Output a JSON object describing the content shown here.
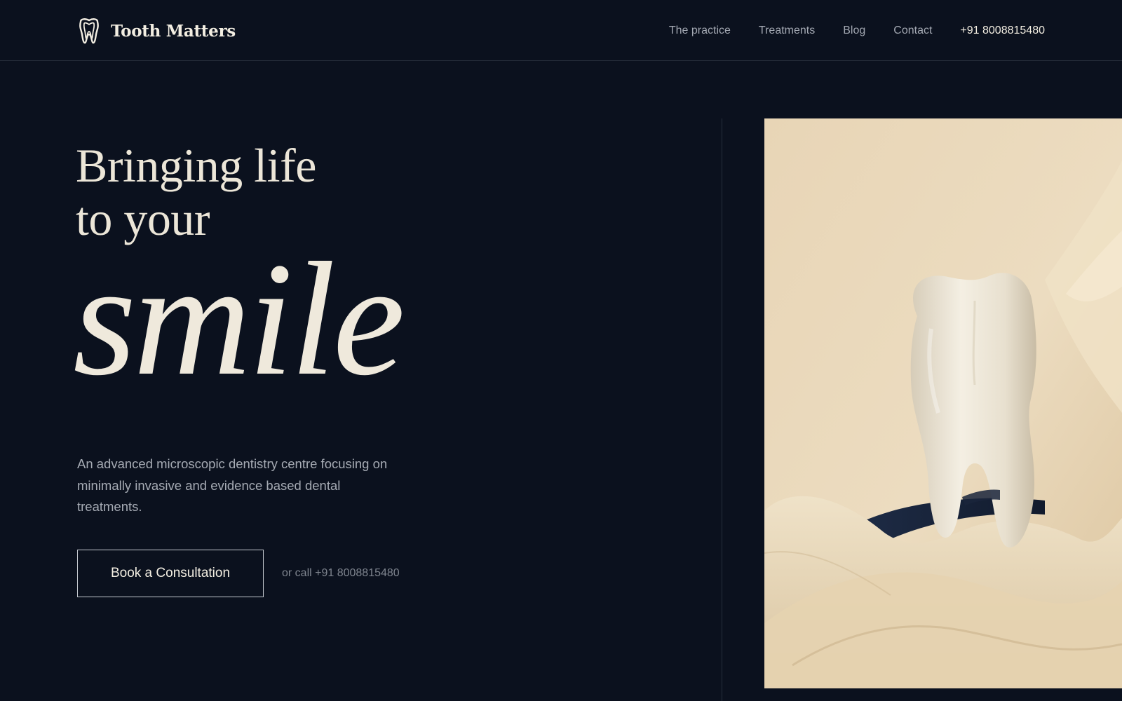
{
  "header": {
    "brand_name": "Tooth Matters",
    "nav": [
      {
        "label": "The practice"
      },
      {
        "label": "Treatments"
      },
      {
        "label": "Blog"
      },
      {
        "label": "Contact"
      }
    ],
    "phone": "+91 8008815480"
  },
  "hero": {
    "title_line1": "Bringing life",
    "title_line2": "to your",
    "script_word": "smile",
    "description": "An advanced microscopic dentistry centre focusing on minimally invasive and evidence based dental treatments.",
    "cta_label": "Book a Consultation",
    "call_text": "or call +91 8008815480",
    "image_icon": "tooth-photo"
  },
  "colors": {
    "background": "#0b111e",
    "text_primary": "#ece6d8",
    "text_muted": "#a6abb4",
    "divider": "#262d3a",
    "image_cream": "#e7d6b8"
  }
}
